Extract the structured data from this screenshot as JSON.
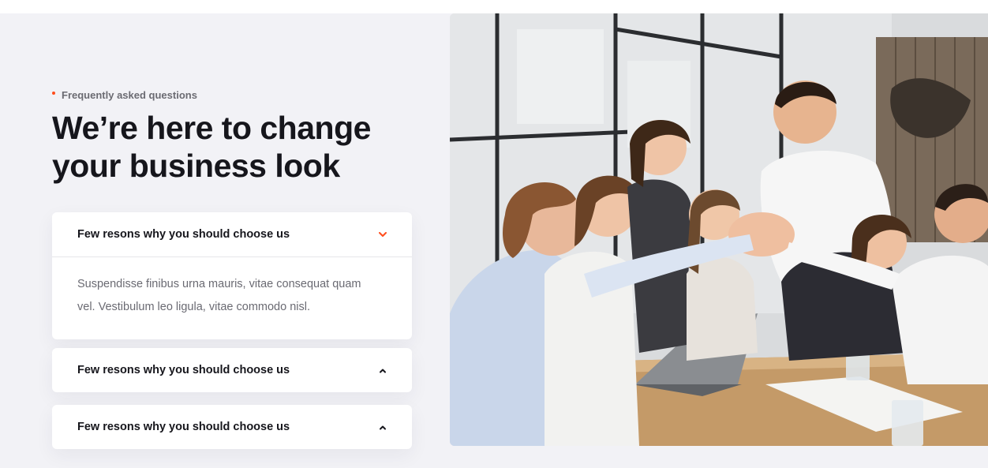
{
  "eyebrow": {
    "text": "Frequently asked questions",
    "dot_color": "#ff4d1c"
  },
  "headline": {
    "line1": "We’re here to change",
    "line2": "your business look"
  },
  "faq": {
    "items": [
      {
        "question": "Few resons why you should choose us",
        "answer": "Suspendisse finibus urna mauris, vitae consequat quam vel. Vestibulum leo ligula, vitae commodo nisl.",
        "expanded": true,
        "icon": "chevron-down-icon"
      },
      {
        "question": "Few resons why you should choose us",
        "expanded": false,
        "icon": "chevron-up-icon"
      },
      {
        "question": "Few resons why you should choose us",
        "expanded": false,
        "icon": "chevron-up-icon"
      }
    ]
  },
  "image": {
    "alt": "Team of colleagues giving a group high five around an office table"
  },
  "colors": {
    "accent": "#ff4d1c",
    "background": "#f2f2f6",
    "heading": "#16161c"
  }
}
